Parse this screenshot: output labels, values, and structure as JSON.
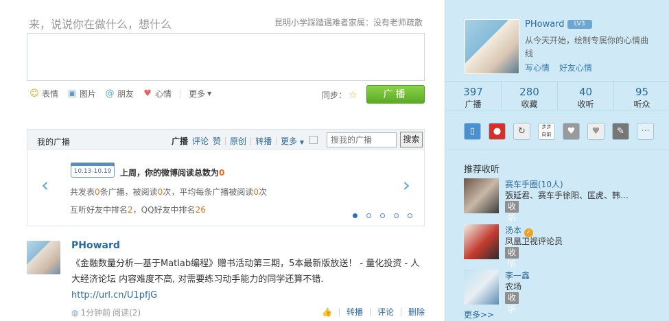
{
  "compose": {
    "prompt": "来，说说你在做什么，想什么",
    "topic": "昆明小学踩踏遇难者家属：没有老师疏散",
    "tools": [
      {
        "icon": "smiley-icon",
        "label": "表情"
      },
      {
        "icon": "image-icon",
        "label": "图片"
      },
      {
        "icon": "at-icon",
        "label": "朋友"
      },
      {
        "icon": "heart-icon",
        "label": "心情"
      }
    ],
    "more_label": "更多",
    "sync_label": "同步：",
    "post_label": "广播"
  },
  "my_broadcast": {
    "title": "我的广播",
    "tabs": [
      "广播",
      "评论",
      "赞",
      "原创",
      "转播",
      "更多"
    ],
    "search_placeholder": "搜我的广播",
    "search_button": "搜索",
    "date_range": "10.13-10.19",
    "week_title_prefix": "上周，你的微博阅读总数为",
    "week_total": "0",
    "line1": {
      "a": "共发表",
      "b": "0",
      "c": "条广播，被阅读",
      "d": "0",
      "e": "次，平均每条广播被阅读",
      "f": "0",
      "g": "次"
    },
    "line2": {
      "a": "互听好友中排名",
      "b": "2",
      "c": "，QQ好友中排名",
      "d": "26"
    }
  },
  "feed": {
    "author": "PHoward",
    "text": "《金融数量分析—基于Matlab编程》赠书活动第三期，5本最新版放送！ - 量化投资 - 人大经济论坛 内容难度不高, 对需要练习动手能力的同学还算不错.",
    "link": "http://url.cn/U1pfjG",
    "time": "1分钟前",
    "reads": "阅读(2)",
    "actions": [
      "转播",
      "评论",
      "删除"
    ]
  },
  "profile": {
    "name": "PHoward",
    "level_badge": "LV3",
    "slogan": "从今天开始，绘制专属你的心情曲线",
    "links": [
      "写心情",
      "好友心情"
    ],
    "stats": [
      {
        "value": "397",
        "label": "广播"
      },
      {
        "value": "280",
        "label": "收藏"
      },
      {
        "value": "40",
        "label": "收听"
      },
      {
        "value": "95",
        "label": "听众"
      }
    ]
  },
  "apps": [
    {
      "icon": "phone-icon",
      "glyph": "▯",
      "color": "#4a8fd0"
    },
    {
      "icon": "bell-icon",
      "glyph": "🔔",
      "color": "#d6302a"
    },
    {
      "icon": "refresh-icon",
      "glyph": "↻",
      "color": "#777777"
    },
    {
      "icon": "steps-icon",
      "glyph": "步步向前",
      "color": "#ffffff"
    },
    {
      "icon": "heart-icon",
      "glyph": "♥",
      "color": "#9a9a9a"
    },
    {
      "icon": "heart-outline-icon",
      "glyph": "♥",
      "color": "#9a9a9a"
    },
    {
      "icon": "tools-icon",
      "glyph": "✎",
      "color": "#777777"
    },
    {
      "icon": "more-icon",
      "glyph": "···",
      "color": "#cfe6f2"
    }
  ],
  "recommend": {
    "title": "推荐收听",
    "items": [
      {
        "name": "赛车手圈(10人)",
        "desc": "張延君、赛车手徐阳、匡虎、韩…",
        "button": "收听全部"
      },
      {
        "name": "汤本",
        "desc": "凤凰卫视评论员",
        "button": "收听"
      },
      {
        "name": "李一鑫",
        "desc": "农场",
        "button": "收听"
      }
    ],
    "more": "更多>>"
  }
}
